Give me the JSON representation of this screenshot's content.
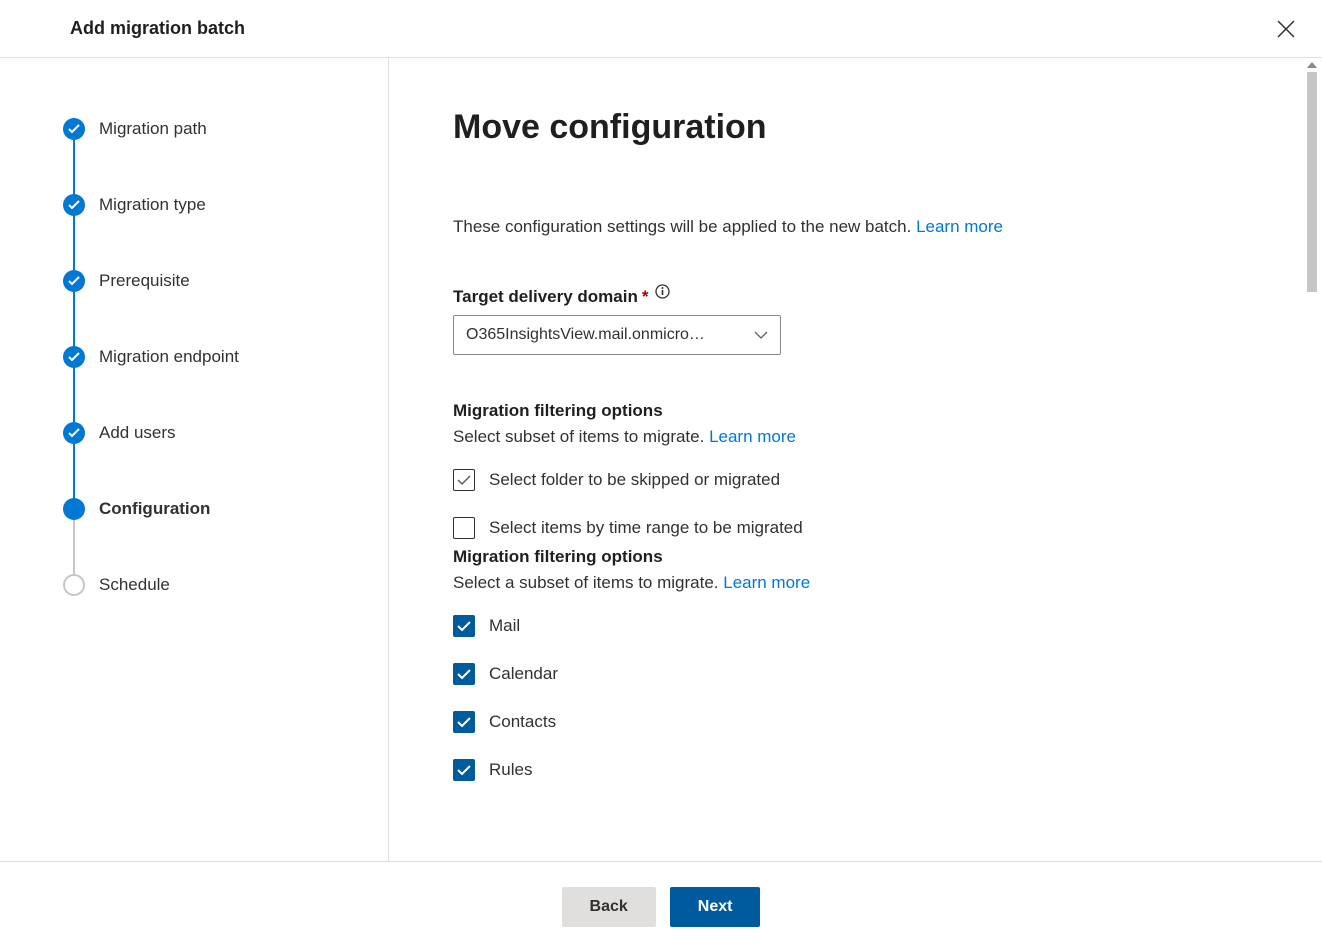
{
  "header": {
    "title": "Add migration batch"
  },
  "stepper": {
    "steps": [
      {
        "label": "Migration path",
        "state": "completed"
      },
      {
        "label": "Migration type",
        "state": "completed"
      },
      {
        "label": "Prerequisite",
        "state": "completed"
      },
      {
        "label": "Migration endpoint",
        "state": "completed"
      },
      {
        "label": "Add users",
        "state": "completed"
      },
      {
        "label": "Configuration",
        "state": "current"
      },
      {
        "label": "Schedule",
        "state": "upcoming"
      }
    ]
  },
  "main": {
    "heading": "Move configuration",
    "intro_text": "These configuration settings will be applied to the new batch. ",
    "learn_more": "Learn more",
    "target_domain": {
      "label": "Target delivery domain",
      "value": "O365InsightsView.mail.onmicro…"
    },
    "filter1": {
      "title": "Migration filtering options",
      "desc": "Select subset of items to migrate. ",
      "cb1_label": "Select folder to be skipped or migrated",
      "cb2_label": "Select items by time range to be migrated"
    },
    "filter2": {
      "title": "Migration filtering options",
      "desc": "Select a subset of items to migrate. ",
      "items": [
        {
          "label": "Mail",
          "checked": true
        },
        {
          "label": "Calendar",
          "checked": true
        },
        {
          "label": "Contacts",
          "checked": true
        },
        {
          "label": "Rules",
          "checked": true
        }
      ]
    }
  },
  "footer": {
    "back": "Back",
    "next": "Next"
  }
}
